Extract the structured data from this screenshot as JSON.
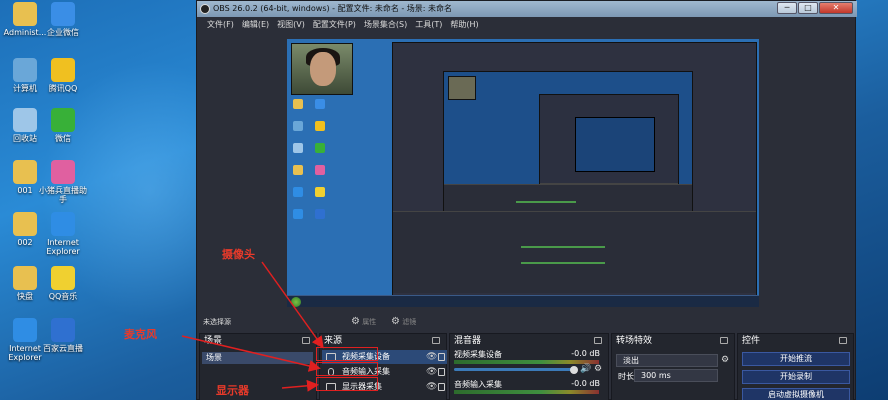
{
  "desktop": {
    "icons": [
      {
        "label": "Administ...",
        "color": "#e8c050"
      },
      {
        "label": "企业微信",
        "color": "#3a8ee6"
      },
      {
        "label": "计算机",
        "color": "#6aa7d8"
      },
      {
        "label": "腾讯QQ",
        "color": "#f0c020"
      },
      {
        "label": "回收站",
        "color": "#9ec6e8"
      },
      {
        "label": "微信",
        "color": "#38b038"
      },
      {
        "label": "001",
        "color": "#e8c050"
      },
      {
        "label": "小猪兵直播助手",
        "color": "#e060a0"
      },
      {
        "label": "002",
        "color": "#e8c050"
      },
      {
        "label": "Internet Explorer",
        "color": "#2f8de4"
      },
      {
        "label": "快盘",
        "color": "#e8c050"
      },
      {
        "label": "QQ音乐",
        "color": "#f0d030"
      },
      {
        "label": "Internet Explorer",
        "color": "#2f8de4"
      },
      {
        "label": "百家云直播",
        "color": "#2f70d0"
      }
    ]
  },
  "window": {
    "title": "OBS 26.0.2 (64-bit, windows) - 配置文件: 未命名 - 场景: 未命名",
    "menu": [
      "文件(F)",
      "编辑(E)",
      "视图(V)",
      "配置文件(P)",
      "场景集合(S)",
      "工具(T)",
      "帮助(H)"
    ],
    "controls": {
      "minimize": "─",
      "maximize": "□",
      "close": "✕"
    }
  },
  "status_row": {
    "no_source": "未选择源",
    "properties": "属性",
    "filters": "滤镜"
  },
  "docks": {
    "scenes": {
      "title": "场景",
      "items": [
        "场景"
      ]
    },
    "sources": {
      "title": "来源",
      "items": [
        {
          "name": "视频采集设备",
          "icon": "camera-icon",
          "selected": true
        },
        {
          "name": "音频输入采集",
          "icon": "microphone-icon",
          "selected": false
        },
        {
          "name": "显示器采集",
          "icon": "monitor-icon",
          "selected": false
        }
      ]
    },
    "mixer": {
      "title": "混音器",
      "tracks": [
        {
          "name": "视频采集设备",
          "db": "-0.0 dB"
        },
        {
          "name": "音频输入采集",
          "db": "-0.0 dB"
        }
      ]
    },
    "transitions": {
      "title": "转场特效",
      "selected": "淡出",
      "duration_label": "时长",
      "duration": "300 ms"
    },
    "controls": {
      "title": "控件",
      "buttons": [
        "开始推流",
        "开始录制",
        "启动虚拟摄像机"
      ]
    }
  },
  "annotations": {
    "camera": "摄像头",
    "microphone": "麦克风",
    "monitor": "显示器",
    "color": "#e02020"
  }
}
